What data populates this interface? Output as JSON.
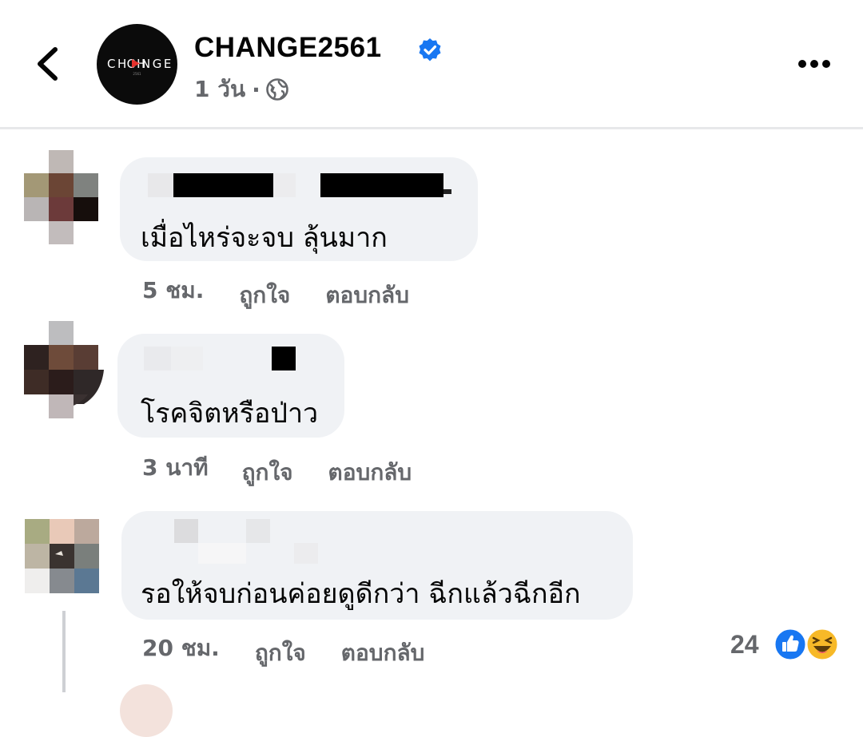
{
  "header": {
    "page_name": "CHANGE2561",
    "avatar_logo_text": "CHANGE",
    "post_time": "1 วัน",
    "dot": "·",
    "icons": [
      "back-arrow-icon",
      "verified-badge-icon",
      "globe-icon",
      "more-options-icon"
    ]
  },
  "comments": [
    {
      "text": "เมื่อไหร่จะจบ ลุ้นมาก",
      "time": "5 ชม.",
      "like_label": "ถูกใจ",
      "reply_label": "ตอบกลับ"
    },
    {
      "text": "โรคจิตหรือป่าว",
      "time": "3 นาที",
      "like_label": "ถูกใจ",
      "reply_label": "ตอบกลับ"
    },
    {
      "text": "รอให้จบก่อนค่อยดูดีกว่า ฉีกแล้วฉีกอีก",
      "time": "20 ชม.",
      "like_label": "ถูกใจ",
      "reply_label": "ตอบกลับ",
      "reaction_count": "24",
      "reactions": [
        "like-reaction-icon",
        "haha-reaction-icon"
      ]
    }
  ],
  "colors": {
    "secondary_text": "#65676b",
    "bubble_bg": "#f0f2f5",
    "verified_blue": "#1877f2",
    "like_blue": "#1877f2",
    "haha_yellow": "#f7b928"
  }
}
